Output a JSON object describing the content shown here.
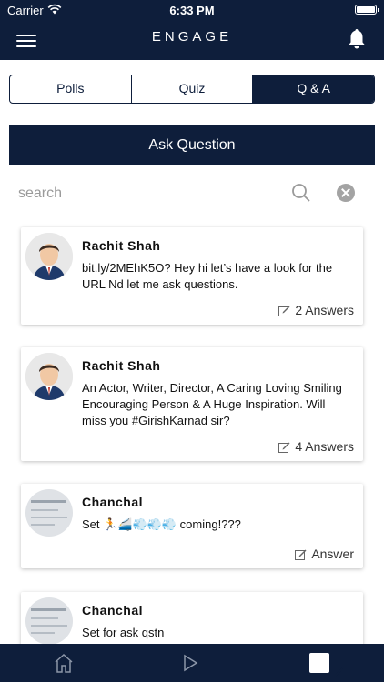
{
  "status_bar": {
    "carrier": "Carrier",
    "time": "6:33 PM"
  },
  "header": {
    "title": "ENGAGE"
  },
  "segments": {
    "polls": "Polls",
    "quiz": "Quiz",
    "qa": "Q & A"
  },
  "ask_button": "Ask Question",
  "search": {
    "placeholder": "search"
  },
  "questions": [
    {
      "name": "Rachit Shah",
      "text": "bit.ly/2MEhK5O? Hey hi let’s have a look for the URL Nd let me ask questions.",
      "answers": "2 Answers"
    },
    {
      "name": "Rachit Shah",
      "text": "An Actor, Writer, Director, A Caring Loving Smiling Encouraging Person & A Huge Inspiration. Will miss you #GirishKarnad sir?",
      "answers": "4 Answers"
    },
    {
      "name": "Chanchal",
      "text": "Set 🏃🚄💨💨💨 coming!???",
      "answers": "Answer"
    },
    {
      "name": "Chanchal",
      "text": "Set for ask qstn",
      "answers": ""
    }
  ],
  "colors": {
    "navy": "#0e1e3b",
    "white": "#ffffff"
  },
  "icons": {
    "menu": "menu-icon",
    "bell": "bell-icon",
    "search": "search-icon",
    "clear": "clear-icon",
    "edit": "edit-icon",
    "home": "home-icon",
    "play": "play-icon",
    "check": "check-icon"
  }
}
